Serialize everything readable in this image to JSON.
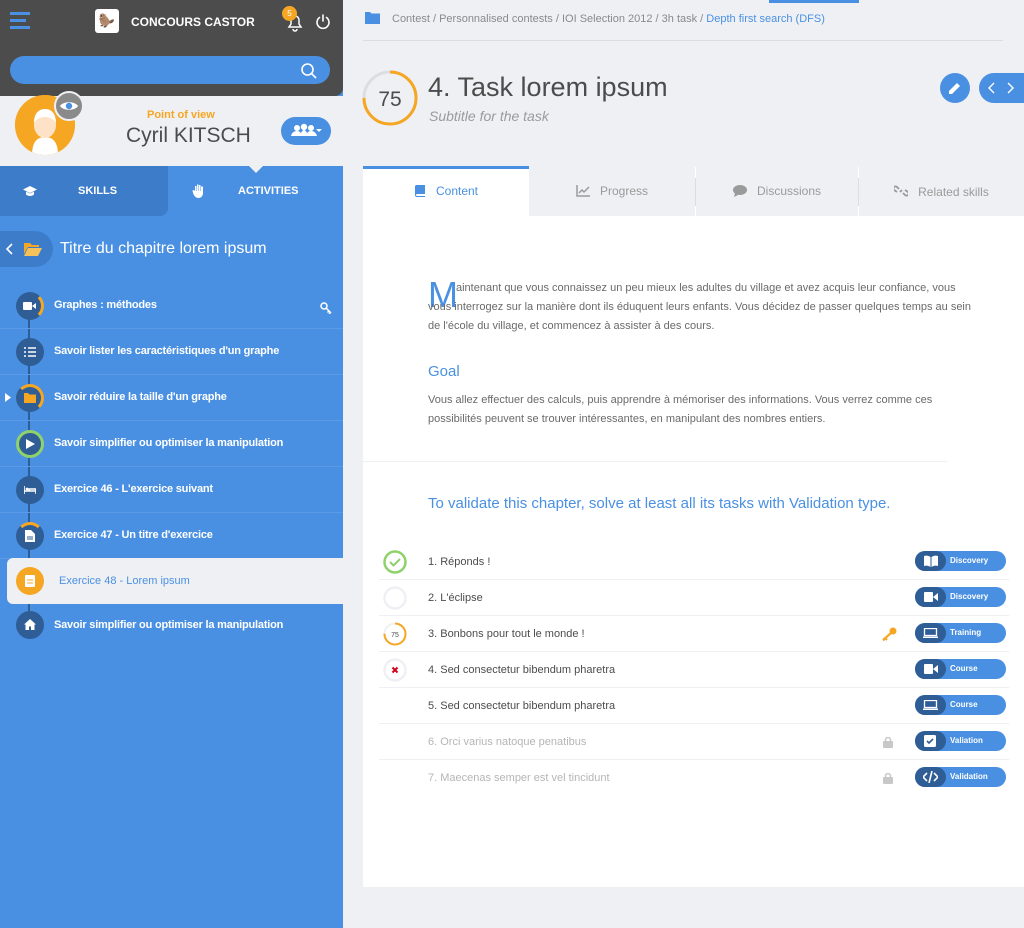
{
  "app": {
    "title": "CONCOURS CASTOR",
    "notifications": "5"
  },
  "search": {
    "placeholder": ""
  },
  "user": {
    "point_of_view": "Point of view",
    "name": "Cyril KITSCH"
  },
  "left_tabs": {
    "skills": "SKILLS",
    "activities": "ACTIVITIES"
  },
  "chapter": {
    "title": "Titre du chapitre lorem ipsum"
  },
  "items": [
    {
      "label": "Graphes : méthodes"
    },
    {
      "label": "Savoir lister les caractéristiques d'un graphe"
    },
    {
      "label": "Savoir réduire la taille d'un graphe"
    },
    {
      "label": "Savoir simplifier ou optimiser la manipulation"
    },
    {
      "label": "Exercice 46 - L'exercice suivant"
    },
    {
      "label": "Exercice 47 - Un titre d'exercice"
    },
    {
      "label": "Exercice 48 - Lorem ipsum"
    },
    {
      "label": "Savoir simplifier ou optimiser la manipulation"
    }
  ],
  "breadcrumb": {
    "path": "Contest / Personnalised contests / IOI Selection 2012 / 3h task /",
    "current": "Depth first search (DFS)"
  },
  "task": {
    "score": "75",
    "title": "4. Task lorem ipsum",
    "subtitle": "Subtitle for the task"
  },
  "tabs": {
    "content": "Content",
    "progress": "Progress",
    "discussions": "Discussions",
    "related": "Related skills"
  },
  "body": {
    "dropcap": "M",
    "intro": "aintenant que vous connaissez un peu mieux les adultes du village et avez acquis leur confiance, vous vous interrogez sur la manière dont ils éduquent leurs enfants. Vous décidez de passer quelques temps au sein de l'école du village, et commencez à assister à des cours.",
    "goal_title": "Goal",
    "goal_text": "Vous allez effectuer des calculs, puis apprendre à mémoriser des informations. Vous verrez comme ces possibilités peuvent se trouver intéressantes, en manipulant des nombres entiers.",
    "validate": "To validate this chapter, solve at least all its tasks with Validation type."
  },
  "tasks": [
    {
      "label": "1. Réponds !",
      "type": "Discovery"
    },
    {
      "label": "2. L'éclipse",
      "type": "Discovery"
    },
    {
      "label": "3. Bonbons pour tout le monde !",
      "type": "Training",
      "score": "75"
    },
    {
      "label": "4. Sed consectetur bibendum pharetra",
      "type": "Course"
    },
    {
      "label": "5. Sed consectetur bibendum pharetra",
      "type": "Course"
    },
    {
      "label": "6. Orci varius natoque penatibus",
      "type": "Valiation"
    },
    {
      "label": "7. Maecenas semper est vel tincidunt",
      "type": "Validation"
    }
  ],
  "colors": {
    "primary": "#4a90e2",
    "dark": "#2f5d96",
    "accent": "#f5a623",
    "success": "#8fd16a",
    "error": "#d0021b"
  }
}
